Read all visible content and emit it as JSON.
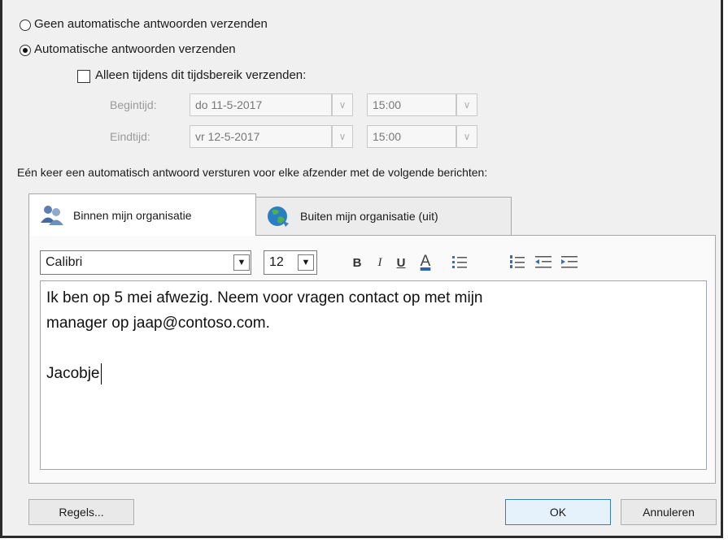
{
  "options": {
    "no_reply_label": "Geen automatische antwoorden verzenden",
    "send_reply_label": "Automatische antwoorden verzenden",
    "time_range_label": "Alleen tijdens dit tijdsbereik verzenden:"
  },
  "schedule": {
    "start_label": "Begintijd:",
    "start_date": "do 11-5-2017",
    "start_time": "15:00",
    "end_label": "Eindtijd:",
    "end_date": "vr 12-5-2017",
    "end_time": "15:00"
  },
  "instruction": "Eén keer een automatisch antwoord versturen voor elke afzender met de volgende berichten:",
  "tabs": [
    {
      "label": "Binnen mijn organisatie",
      "icon": "people-icon"
    },
    {
      "label": "Buiten mijn organisatie (uit)",
      "icon": "globe-icon"
    }
  ],
  "format": {
    "font": "Calibri",
    "size": "12",
    "bold": "B",
    "italic": "I",
    "underline": "U",
    "font_color": "A",
    "font_color_value": "#2e64b4"
  },
  "message": {
    "line1": "Ik ben op 5 mei afwezig. Neem voor vragen contact op met mijn",
    "line2": "manager op jaap@contoso.com.",
    "line3": "Jacobje"
  },
  "buttons": {
    "rules": "Regels...",
    "ok": "OK",
    "cancel": "Annuleren"
  }
}
